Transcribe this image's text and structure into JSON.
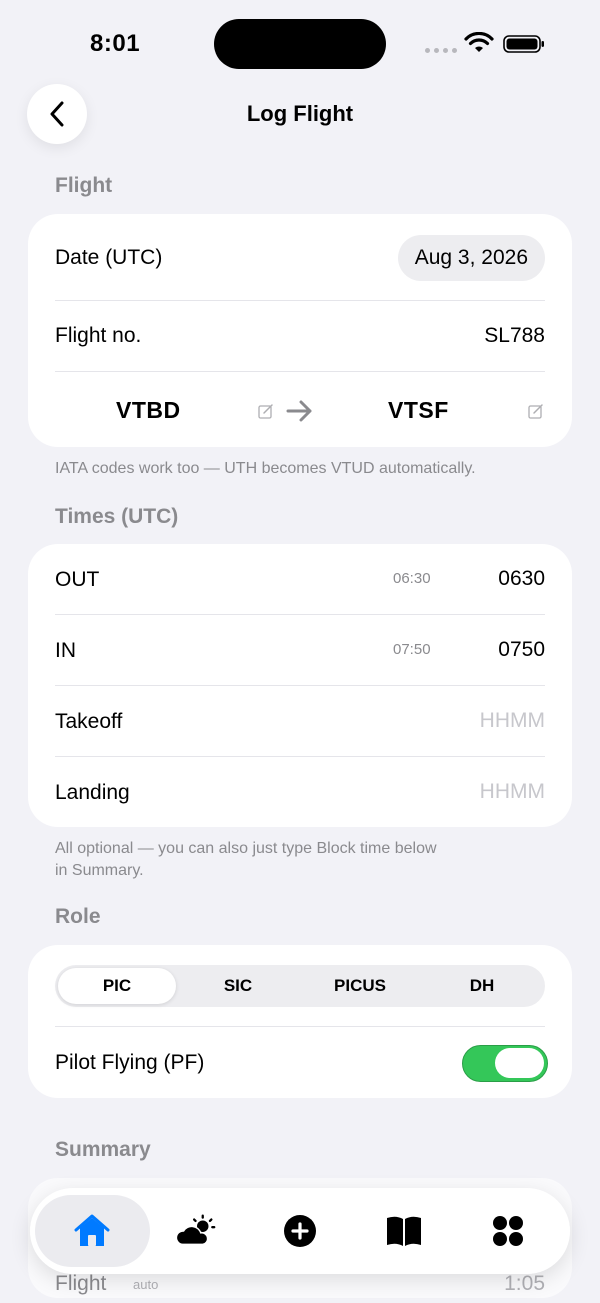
{
  "status_bar": {
    "time": "8:01"
  },
  "nav": {
    "title": "Log Flight",
    "back_icon": "chevron-left-icon"
  },
  "flight_section": {
    "header": "Flight",
    "date_label": "Date (UTC)",
    "date_value": "Aug 3, 2026",
    "flight_no_label": "Flight no.",
    "flight_no_value": "SL788",
    "origin": "VTBD",
    "destination": "VTSF",
    "footnote": "IATA codes work too — UTH becomes VTUD automatically."
  },
  "times_section": {
    "header": "Times (UTC)",
    "rows": [
      {
        "label": "OUT",
        "hint": "06:30",
        "value": "0630"
      },
      {
        "label": "IN",
        "hint": "07:50",
        "value": "0750"
      },
      {
        "label": "Takeoff",
        "placeholder": "HHMM"
      },
      {
        "label": "Landing",
        "placeholder": "HHMM"
      }
    ],
    "footnote_line1": "All optional — you can also just type Block time below",
    "footnote_line2": "in Summary."
  },
  "role_section": {
    "header": "Role",
    "segments": [
      "PIC",
      "SIC",
      "PICUS",
      "DH"
    ],
    "selected_segment": "PIC",
    "pf_label": "Pilot Flying (PF)",
    "pf_enabled": true
  },
  "summary_section": {
    "header": "Summary",
    "partial_row_label": "Flight",
    "partial_row_badge": "auto",
    "partial_row_value": "1:05"
  },
  "tab_bar": {
    "tabs": [
      {
        "icon": "home-icon",
        "selected": true
      },
      {
        "icon": "weather-icon",
        "selected": false
      },
      {
        "icon": "add-circle-icon",
        "selected": false
      },
      {
        "icon": "logbook-icon",
        "selected": false
      },
      {
        "icon": "apps-grid-icon",
        "selected": false
      }
    ]
  },
  "colors": {
    "background": "#F2F2F7",
    "accent": "#007AFF",
    "toggle_on": "#34C759",
    "secondary_text": "#8A8A8E",
    "placeholder_text": "#C7C7CC"
  }
}
